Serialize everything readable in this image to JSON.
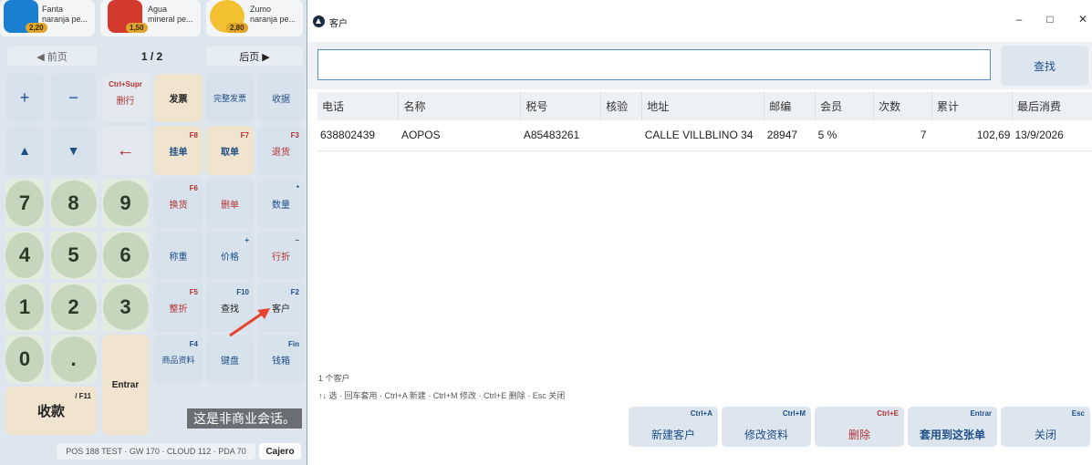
{
  "products": [
    {
      "name": "Fanta\nnaranja pe...",
      "price": "2,20",
      "icon": "fanta-can-icon",
      "color": "#1a7fd0"
    },
    {
      "name": "Agua\nmineral pe...",
      "price": "1,50",
      "icon": "water-bottle-icon",
      "color": "#d23a2e"
    },
    {
      "name": "Zumo\nnaranja pe...",
      "price": "2,80",
      "icon": "orange-juice-icon",
      "color": "#f2c030"
    }
  ],
  "pager": {
    "prev": "◀ 前页",
    "indicator": "1 / 2",
    "next": "后页 ▶"
  },
  "keypad": {
    "plus": "+",
    "minus": "−",
    "delete_line": "删行",
    "delete_line_short": "Ctrl+Supr",
    "invoice": "发票",
    "full_invoice": "完整发票",
    "receipt": "收据",
    "up": "▲",
    "down": "▼",
    "backspace": "←",
    "hold": "挂单",
    "hold_short": "F8",
    "retrieve": "取单",
    "retrieve_short": "F7",
    "return": "退货",
    "return_short": "F3",
    "exchange": "换货",
    "exchange_short": "F6",
    "delete_ticket": "删单",
    "quantity": "数量",
    "quantity_short": "*",
    "weigh": "称重",
    "price": "价格",
    "price_short": "+",
    "line_discount": "行折",
    "line_discount_short": "−",
    "total_discount": "整折",
    "total_discount_short": "F5",
    "find": "查找",
    "find_short": "F10",
    "customer": "客户",
    "customer_short": "F2",
    "product_data": "商品资料",
    "product_data_short": "F4",
    "keyboard": "键盘",
    "cash_drawer": "钱箱",
    "cash_drawer_short": "Fin",
    "digits": [
      "7",
      "8",
      "9",
      "4",
      "5",
      "6",
      "1",
      "2",
      "3",
      "0",
      "."
    ],
    "enter": "Entrar",
    "pay": "收款",
    "pay_short": "/ F11"
  },
  "watermark": "这是非商业会话。",
  "statusbar": "POS 188 TEST · GW 170 · CLOUD 112 · PDA 70",
  "cashier": "Cajero",
  "window": {
    "title": "客户",
    "controls": {
      "minimize": "–",
      "maximize": "□",
      "close": "✕"
    },
    "search": {
      "value": "",
      "placeholder": "",
      "button": "查找"
    },
    "columns": [
      "电话",
      "名称",
      "税号",
      "核验",
      "地址",
      "邮编",
      "会员",
      "次数",
      "累计",
      "最后消费"
    ],
    "rows": [
      [
        "638802439",
        "AOPOS",
        "A85483261",
        "",
        "CALLE VILLBLINO 34",
        "28947",
        "5 %",
        "7",
        "102,69",
        "13/9/2026"
      ]
    ],
    "count": "1 个客户",
    "hint": "↑↓ 选 · 回车套用 · Ctrl+A 新建 · Ctrl+M 修改 · Ctrl+E 删除 · Esc 关闭",
    "actions": [
      {
        "label": "新建客户",
        "short": "Ctrl+A"
      },
      {
        "label": "修改资料",
        "short": "Ctrl+M"
      },
      {
        "label": "删除",
        "short": "Ctrl+E"
      },
      {
        "label": "套用到这张单",
        "short": "Entrar"
      },
      {
        "label": "关闭",
        "short": "Esc"
      }
    ]
  },
  "colors": {
    "accent": "#1f4f86",
    "danger": "#b13232",
    "arrow": "#e8432f"
  }
}
